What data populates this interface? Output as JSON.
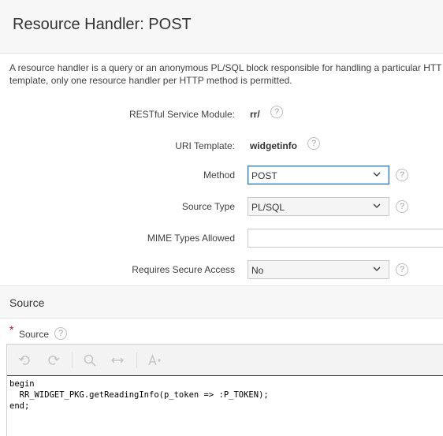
{
  "header": {
    "title": "Resource Handler: POST"
  },
  "description": {
    "line1": "A resource handler is a query or an anonymous PL/SQL block responsible for handling a particular HTT",
    "line2": "template, only one resource handler per HTTP method is permitted."
  },
  "form": {
    "module": {
      "label": "RESTful Service Module:",
      "value": "rr/"
    },
    "uri_template": {
      "label": "URI Template:",
      "value": "widgetinfo"
    },
    "method": {
      "label": "Method",
      "value": "POST"
    },
    "source_type": {
      "label": "Source Type",
      "value": "PL/SQL"
    },
    "mime_types": {
      "label": "MIME Types Allowed",
      "value": ""
    },
    "secure_access": {
      "label": "Requires Secure Access",
      "value": "No"
    },
    "help_glyph": "?"
  },
  "source_region": {
    "title": "Source",
    "field_label": "Source",
    "required_mark": "*",
    "toolbar": {
      "icons": [
        "undo-icon",
        "redo-icon",
        "search-icon",
        "replace-icon",
        "font-size-icon"
      ]
    },
    "code": "begin\n  RR_WIDGET_PKG.getReadingInfo(p_token => :P_TOKEN);\nend;"
  },
  "colors": {
    "accent": "#1a73c6",
    "required": "#d0021b",
    "header_bg": "#f7f7f7"
  }
}
